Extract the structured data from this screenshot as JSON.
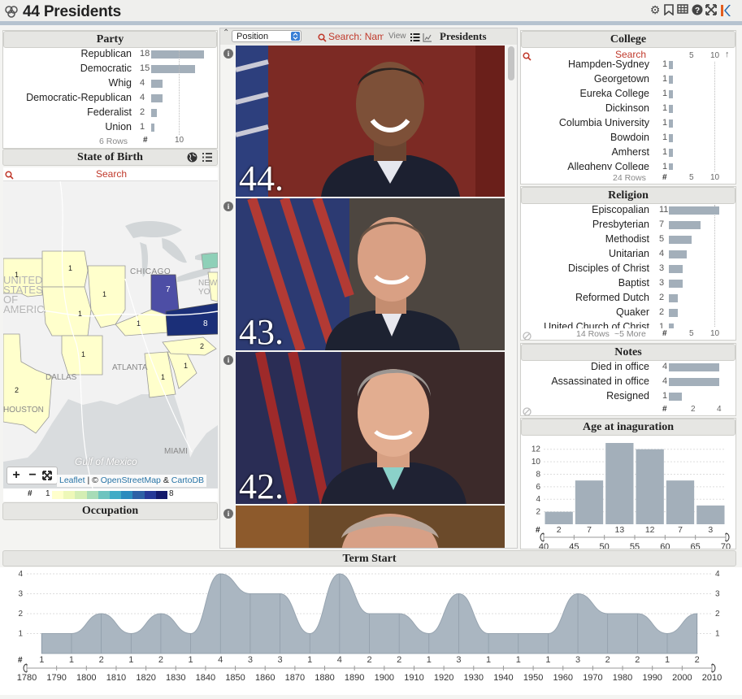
{
  "app": {
    "title": "44 Presidents"
  },
  "toolbar_icons": [
    "gear-icon",
    "bookmark-icon",
    "table-icon",
    "help-icon",
    "fullscreen-icon",
    "keshif-logo-icon"
  ],
  "party": {
    "title": "Party",
    "rows": [
      {
        "label": "Republican",
        "count": 18
      },
      {
        "label": "Democratic",
        "count": 15
      },
      {
        "label": "Whig",
        "count": 4
      },
      {
        "label": "Democratic-Republican",
        "count": 4
      },
      {
        "label": "Federalist",
        "count": 2
      },
      {
        "label": "Union",
        "count": 1
      }
    ],
    "footer": "6 Rows",
    "axis_hash": "#",
    "axis_tick": "10"
  },
  "state_of_birth": {
    "title": "State of Birth",
    "search_placeholder": "Search",
    "map_labels": [
      "CHICAGO",
      "UNITED STATES OF AMERICA",
      "ATLANTA",
      "DALLAS",
      "HOUSTON",
      "MIAMI",
      "Gulf of Mexico",
      "NEW YO"
    ],
    "counts": [
      "1",
      "1",
      "1",
      "7",
      "1",
      "1",
      "8",
      "1",
      "2",
      "1",
      "1",
      "2"
    ],
    "attribution": {
      "leaflet": "Leaflet",
      "sep": "| ©",
      "osm": "OpenStreetMap",
      "amp": "&",
      "carto": "CartoDB"
    },
    "legend_hash": "#",
    "legend_min": "1",
    "legend_max": "8",
    "legend_colors": [
      "#ffffcc",
      "#eef8b8",
      "#d4eeb4",
      "#a7dcb7",
      "#6ec4bf",
      "#41abc6",
      "#2a8bbe",
      "#2c60a6",
      "#253897",
      "#13196b"
    ]
  },
  "occupation": {
    "title": "Occupation"
  },
  "presidents": {
    "title": "Presidents",
    "sort_select": "Position",
    "search_placeholder": "Search: Nam",
    "view_label": "View",
    "cards": [
      {
        "number": "44."
      },
      {
        "number": "43."
      },
      {
        "number": "42."
      },
      {
        "number": ""
      }
    ]
  },
  "college": {
    "title": "College",
    "search_placeholder": "Search",
    "axis_ticks": [
      "5",
      "10"
    ],
    "rows": [
      {
        "label": "Hampden-Sydney",
        "count": 1
      },
      {
        "label": "Georgetown",
        "count": 1
      },
      {
        "label": "Eureka College",
        "count": 1
      },
      {
        "label": "Dickinson",
        "count": 1
      },
      {
        "label": "Columbia University",
        "count": 1
      },
      {
        "label": "Bowdoin",
        "count": 1
      },
      {
        "label": "Amherst",
        "count": 1
      },
      {
        "label": "Allegheny College",
        "count": 1
      }
    ],
    "footer": "24 Rows",
    "axis_hash": "#"
  },
  "religion": {
    "title": "Religion",
    "rows": [
      {
        "label": "Episcopalian",
        "count": 11
      },
      {
        "label": "Presbyterian",
        "count": 7
      },
      {
        "label": "Methodist",
        "count": 5
      },
      {
        "label": "Unitarian",
        "count": 4
      },
      {
        "label": "Disciples of Christ",
        "count": 3
      },
      {
        "label": "Baptist",
        "count": 3
      },
      {
        "label": "Reformed Dutch",
        "count": 2
      },
      {
        "label": "Quaker",
        "count": 2
      },
      {
        "label": "United Church of Christ",
        "count": 1
      }
    ],
    "footer": "14 Rows ",
    "more": "~5 More",
    "axis_hash": "#",
    "axis_ticks": [
      "5",
      "10"
    ]
  },
  "notes": {
    "title": "Notes",
    "rows": [
      {
        "label": "Died in office",
        "count": 4
      },
      {
        "label": "Assassinated in office",
        "count": 4
      },
      {
        "label": "Resigned",
        "count": 1
      }
    ],
    "axis_hash": "#",
    "axis_ticks": [
      "2",
      "4"
    ]
  },
  "age": {
    "title": "Age at inaguration",
    "axis_hash": "#"
  },
  "term": {
    "title": "Term Start",
    "axis_hash": "#"
  },
  "chart_data": [
    {
      "type": "bar",
      "title": "Age at inaguration",
      "categories": [
        "40-45",
        "45-50",
        "50-55",
        "55-60",
        "60-65",
        "65-70"
      ],
      "values": [
        2,
        7,
        13,
        12,
        7,
        3
      ],
      "x_ticks": [
        "40",
        "45",
        "50",
        "55",
        "60",
        "65",
        "70"
      ],
      "y_ticks": [
        "2",
        "4",
        "6",
        "8",
        "10",
        "12"
      ],
      "ylim": [
        0,
        13
      ]
    },
    {
      "type": "area",
      "title": "Term Start",
      "x": [
        1785,
        1795,
        1805,
        1815,
        1825,
        1835,
        1845,
        1855,
        1865,
        1875,
        1885,
        1895,
        1905,
        1915,
        1925,
        1935,
        1945,
        1955,
        1965,
        1975,
        1985,
        1995,
        2005
      ],
      "values": [
        1,
        1,
        2,
        1,
        2,
        1,
        4,
        3,
        3,
        1,
        4,
        2,
        2,
        1,
        3,
        1,
        1,
        1,
        3,
        2,
        2,
        1,
        2
      ],
      "x_ticks": [
        "1780",
        "1790",
        "1800",
        "1810",
        "1820",
        "1830",
        "1840",
        "1850",
        "1860",
        "1870",
        "1880",
        "1890",
        "1900",
        "1910",
        "1920",
        "1930",
        "1940",
        "1950",
        "1960",
        "1970",
        "1980",
        "1990",
        "2000",
        "2010"
      ],
      "y_ticks": [
        "1",
        "2",
        "3",
        "4"
      ],
      "ylim": [
        0,
        4
      ]
    }
  ]
}
